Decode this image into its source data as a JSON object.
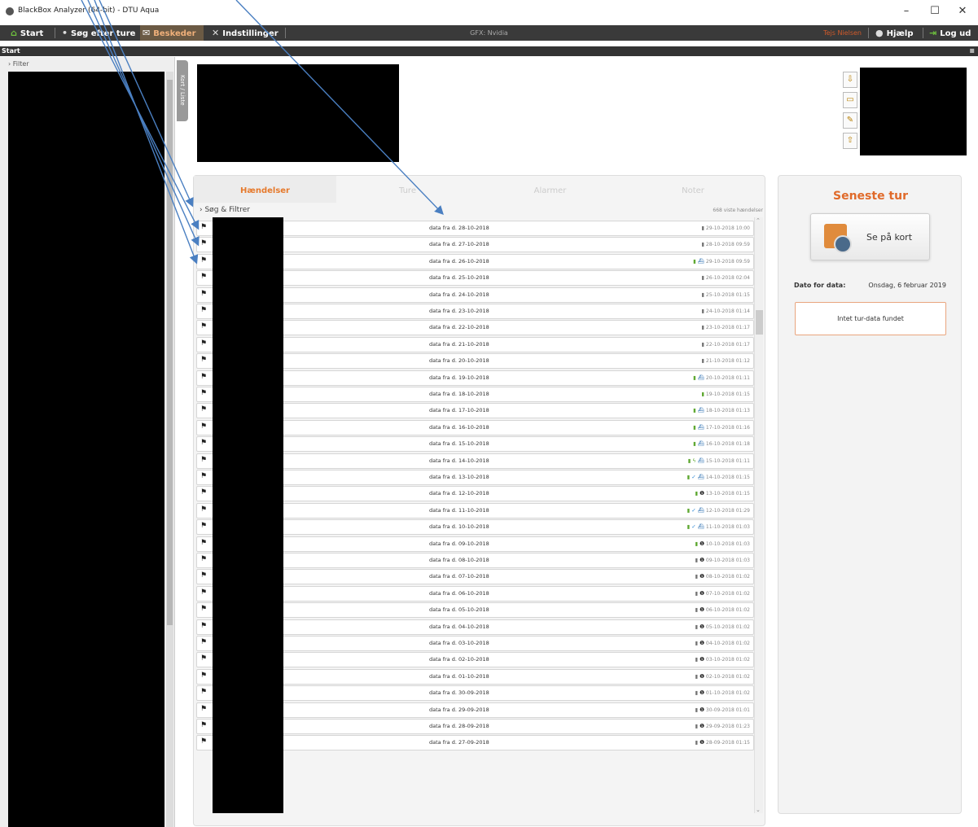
{
  "window": {
    "title": "BlackBox Analyzer (64-bit) - DTU Aqua",
    "controls": [
      "–",
      "☐",
      "✕"
    ]
  },
  "menu": {
    "start": "Start",
    "search": "Søg efter ture",
    "messages": "Beskeder",
    "settings": "Indstillinger",
    "gfx": "GFX: Nvidia",
    "user": "Tejs Nielsen",
    "help": "Hjælp",
    "logout": "Log ud"
  },
  "breadcrumb": "Start",
  "sidebar": {
    "filter": "Filter",
    "collapsed_tab": "Kort / Liste"
  },
  "events": {
    "tabs": [
      "Hændelser",
      "Ture",
      "Alarmer",
      "Noter"
    ],
    "active_tab": "Hændelser",
    "search_label": "Søg & Filtrer",
    "count": "668 viste hændelser",
    "rows": [
      {
        "label": "data fra d. 28-10-2018",
        "ts": "29-10-2018 10:00",
        "icons": [
          "bat-gray"
        ]
      },
      {
        "label": "data fra d. 27-10-2018",
        "ts": "28-10-2018 09:59",
        "icons": [
          "bat-gray"
        ]
      },
      {
        "label": "data fra d. 26-10-2018",
        "ts": "29-10-2018 09:59",
        "icons": [
          "bat",
          "ship"
        ]
      },
      {
        "label": "data fra d. 25-10-2018",
        "ts": "26-10-2018 02:04",
        "icons": [
          "bat-gray"
        ]
      },
      {
        "label": "data fra d. 24-10-2018",
        "ts": "25-10-2018 01:15",
        "icons": [
          "bat-gray"
        ]
      },
      {
        "label": "data fra d. 23-10-2018",
        "ts": "24-10-2018 01:14",
        "icons": [
          "bat-gray"
        ]
      },
      {
        "label": "data fra d. 22-10-2018",
        "ts": "23-10-2018 01:17",
        "icons": [
          "bat-gray"
        ]
      },
      {
        "label": "data fra d. 21-10-2018",
        "ts": "22-10-2018 01:17",
        "icons": [
          "bat-gray"
        ]
      },
      {
        "label": "data fra d. 20-10-2018",
        "ts": "21-10-2018 01:12",
        "icons": [
          "bat-gray"
        ]
      },
      {
        "label": "data fra d. 19-10-2018",
        "ts": "20-10-2018 01:11",
        "icons": [
          "bat",
          "ship"
        ]
      },
      {
        "label": "data fra d. 18-10-2018",
        "ts": "19-10-2018 01:15",
        "icons": [
          "bat"
        ]
      },
      {
        "label": "data fra d. 17-10-2018",
        "ts": "18-10-2018 01:13",
        "icons": [
          "bat",
          "ship"
        ]
      },
      {
        "label": "data fra d. 16-10-2018",
        "ts": "17-10-2018 01:16",
        "icons": [
          "bat",
          "ship"
        ]
      },
      {
        "label": "data fra d. 15-10-2018",
        "ts": "16-10-2018 01:18",
        "icons": [
          "bat",
          "ship"
        ]
      },
      {
        "label": "data fra d. 14-10-2018",
        "ts": "15-10-2018 01:11",
        "icons": [
          "bat",
          "bolt",
          "ship"
        ]
      },
      {
        "label": "data fra d. 13-10-2018",
        "ts": "14-10-2018 01:15",
        "icons": [
          "bat",
          "check",
          "ship"
        ]
      },
      {
        "label": "data fra d. 12-10-2018",
        "ts": "13-10-2018 01:15",
        "icons": [
          "bat",
          "info"
        ]
      },
      {
        "label": "data fra d. 11-10-2018",
        "ts": "12-10-2018 01:29",
        "icons": [
          "bat",
          "check",
          "ship"
        ]
      },
      {
        "label": "data fra d. 10-10-2018",
        "ts": "11-10-2018 01:03",
        "icons": [
          "bat",
          "check",
          "ship"
        ]
      },
      {
        "label": "data fra d. 09-10-2018",
        "ts": "10-10-2018 01:03",
        "icons": [
          "bat",
          "info"
        ]
      },
      {
        "label": "data fra d. 08-10-2018",
        "ts": "09-10-2018 01:03",
        "icons": [
          "bat-gray",
          "info"
        ]
      },
      {
        "label": "data fra d. 07-10-2018",
        "ts": "08-10-2018 01:02",
        "icons": [
          "bat-gray",
          "info"
        ]
      },
      {
        "label": "data fra d. 06-10-2018",
        "ts": "07-10-2018 01:02",
        "icons": [
          "bat-gray",
          "info"
        ]
      },
      {
        "label": "data fra d. 05-10-2018",
        "ts": "06-10-2018 01:02",
        "icons": [
          "bat-gray",
          "info"
        ]
      },
      {
        "label": "data fra d. 04-10-2018",
        "ts": "05-10-2018 01:02",
        "icons": [
          "bat-gray",
          "info"
        ]
      },
      {
        "label": "data fra d. 03-10-2018",
        "ts": "04-10-2018 01:02",
        "icons": [
          "bat-gray",
          "info"
        ]
      },
      {
        "label": "data fra d. 02-10-2018",
        "ts": "03-10-2018 01:02",
        "icons": [
          "bat-gray",
          "info"
        ]
      },
      {
        "label": "data fra d. 01-10-2018",
        "ts": "02-10-2018 01:02",
        "icons": [
          "bat-gray",
          "info"
        ]
      },
      {
        "label": "data fra d. 30-09-2018",
        "ts": "01-10-2018 01:02",
        "icons": [
          "bat-gray",
          "info"
        ]
      },
      {
        "label": "data fra d. 29-09-2018",
        "ts": "30-09-2018 01:01",
        "icons": [
          "bat-gray",
          "info"
        ]
      },
      {
        "label": "data fra d. 28-09-2018",
        "ts": "29-09-2018 01:23",
        "icons": [
          "bat-gray",
          "info"
        ]
      },
      {
        "label": "data fra d. 27-09-2018",
        "ts": "28-09-2018 01:15",
        "icons": [
          "bat-gray",
          "info"
        ]
      }
    ]
  },
  "trip": {
    "title": "Seneste tur",
    "map_button": "Se på kort",
    "date_label": "Dato for data:",
    "date_value": "Onsdag, 6 februar 2019",
    "no_data": "Intet tur-data fundet"
  },
  "colors": {
    "accent": "#e06a2a",
    "menubar": "#3a3a3a",
    "annotation": "#4a7fc1"
  }
}
